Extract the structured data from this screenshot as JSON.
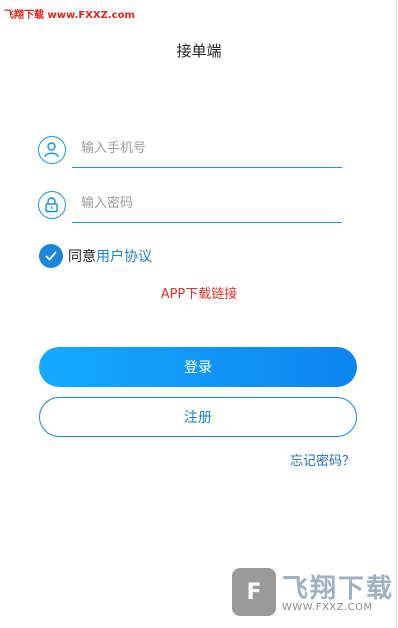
{
  "watermark": {
    "top_text": "飞翔下载 www.FXXZ.com",
    "logo_text": "飞翔下载",
    "logo_url": "WWW.FXXZ.COM"
  },
  "header": {
    "title": "接单端"
  },
  "form": {
    "phone": {
      "placeholder": "输入手机号",
      "value": "",
      "icon": "user-icon"
    },
    "password": {
      "placeholder": "输入密码",
      "value": "",
      "icon": "lock-icon"
    }
  },
  "agreement": {
    "checked": true,
    "prefix": "同意",
    "link_text": "用户协议"
  },
  "app_download_link": "APP下载链接",
  "buttons": {
    "login": "登录",
    "register": "注册"
  },
  "forgot_password": "忘记密码？",
  "colors": {
    "primary": "#1d86d8",
    "link_red": "#e0352b",
    "gradient_start": "#14aaff",
    "gradient_end": "#0d84f0"
  }
}
